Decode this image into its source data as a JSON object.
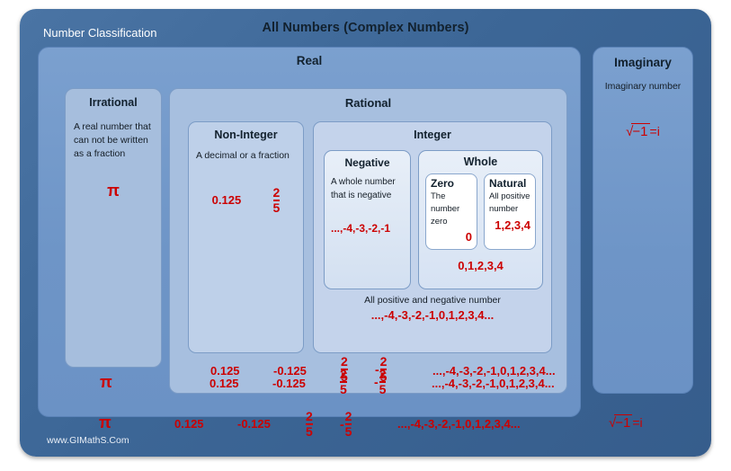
{
  "diagram": {
    "corner_label": "Number Classification",
    "title": "All Numbers (Complex Numbers)",
    "watermark": "www.GIMathS.Com",
    "accent_red": "#cc0000",
    "frame_blue": "#3d6798",
    "real_blue": "#6f96c8",
    "rational_blue": "#a7bfdf",
    "integer_blue": "#c4d3eb",
    "whole_blue": "#e1eaf6"
  },
  "real": {
    "title": "Real"
  },
  "imaginary": {
    "title": "Imaginary",
    "description": "Imaginary number",
    "expression": "√−1=i",
    "radical_sign": "√",
    "radicand": "−1",
    "equals_i": "=i"
  },
  "irrational": {
    "title": "Irrational",
    "description": "A real number that can not be written as a fraction",
    "example": "π"
  },
  "rational": {
    "title": "Rational"
  },
  "non_integer": {
    "title": "Non-Integer",
    "description": "A decimal or a fraction",
    "decimal": "0.125",
    "fraction_numerator": "2",
    "fraction_denominator": "5"
  },
  "integer": {
    "title": "Integer",
    "description": "All positive  and negative number",
    "example": "...,-4,-3,-2,-1,0,1,2,3,4..."
  },
  "negative": {
    "title": "Negative",
    "description": "A whole number that is negative",
    "example": "...,-4,-3,-2,-1"
  },
  "whole": {
    "title": "Whole",
    "example": "0,1,2,3,4"
  },
  "zero": {
    "title": "Zero",
    "description": "The number zero",
    "example": "0"
  },
  "natural": {
    "title": "Natural",
    "description": "All positive number",
    "example": "1,2,3,4"
  },
  "summary_rows": {
    "rational": {
      "decimal_positive": "0.125",
      "decimal_negative": "-0.125",
      "fraction_numerator": "2",
      "fraction_denominator": "5",
      "fraction_neg_sign": "-",
      "integers": "...,-4,-3,-2,-1,0,1,2,3,4..."
    },
    "real": {
      "pi": "π",
      "decimal_positive": "0.125",
      "decimal_negative": "-0.125",
      "fraction_numerator": "2",
      "fraction_denominator": "5",
      "fraction_neg_sign": "-",
      "integers": "...,-4,-3,-2,-1,0,1,2,3,4..."
    },
    "all_numbers": {
      "pi": "π",
      "decimal_positive": "0.125",
      "decimal_negative": "-0.125",
      "fraction_numerator": "2",
      "fraction_denominator": "5",
      "fraction_neg_sign": "-",
      "integers": "...,-4,-3,-2,-1,0,1,2,3,4...",
      "imaginary": "√−1=i"
    }
  }
}
